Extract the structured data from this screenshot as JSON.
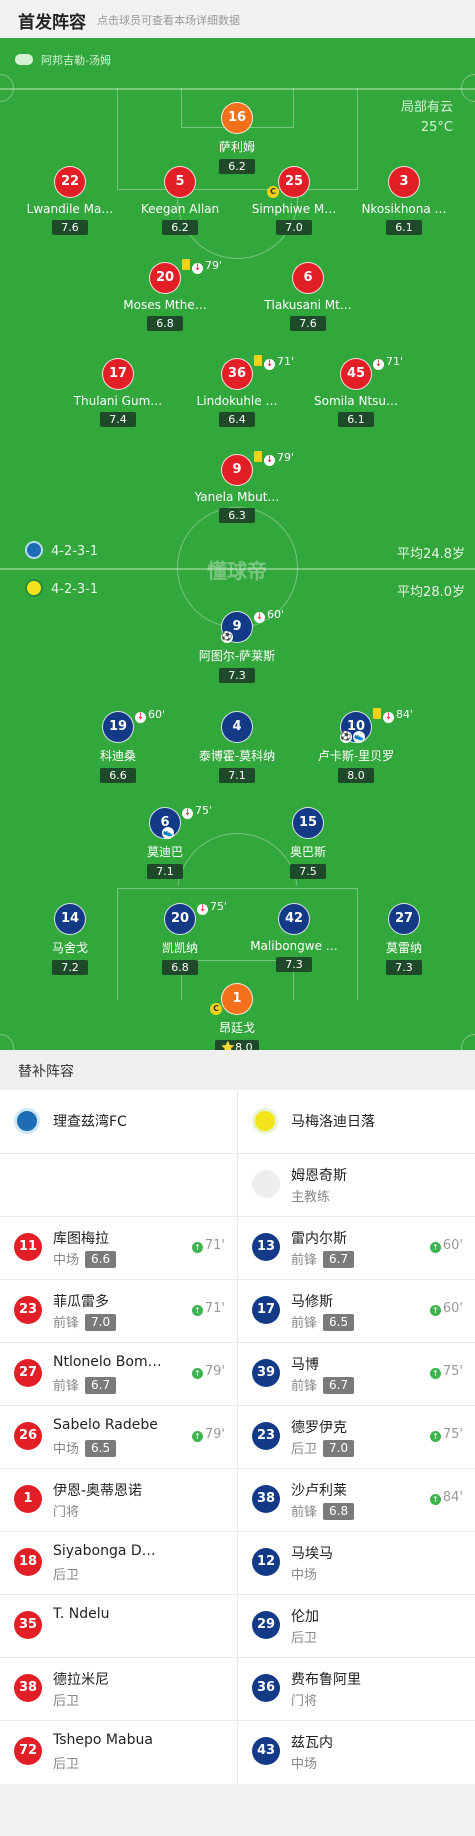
{
  "header": {
    "title": "首发阵容",
    "subtitle": "点击球员可查看本场详细数据"
  },
  "pitch": {
    "referee": "阿邦吉勒-汤姆",
    "weather": {
      "condition": "局部有云",
      "temperature": "25°C"
    },
    "watermark": "懂球帝",
    "home": {
      "formation": "4-2-3-1",
      "avg_age": "平均24.8岁"
    },
    "away": {
      "formation": "4-2-3-1",
      "avg_age": "平均28.0岁"
    }
  },
  "top_players": [
    {
      "num": "16",
      "name": "萨利姆",
      "rating": "6.2",
      "color": "gk"
    },
    {
      "num": "22",
      "name": "Lwandile Ma…",
      "rating": "7.6",
      "color": "red"
    },
    {
      "num": "5",
      "name": "Keegan Allan",
      "rating": "6.2",
      "color": "red"
    },
    {
      "num": "25",
      "name": "Simphiwe M…",
      "rating": "7.0",
      "color": "red",
      "captain": "C"
    },
    {
      "num": "3",
      "name": "Nkosikhona …",
      "rating": "6.1",
      "color": "red"
    },
    {
      "num": "20",
      "name": "Moses Mthe…",
      "rating": "6.8",
      "color": "red",
      "event": "79'",
      "yellow": true
    },
    {
      "num": "6",
      "name": "Tlakusani Mt…",
      "rating": "7.6",
      "color": "red"
    },
    {
      "num": "17",
      "name": "Thulani Gum…",
      "rating": "7.4",
      "color": "red"
    },
    {
      "num": "36",
      "name": "Lindokuhle …",
      "rating": "6.4",
      "color": "red",
      "event": "71'",
      "yellow": true
    },
    {
      "num": "45",
      "name": "Somila Ntsu…",
      "rating": "6.1",
      "color": "red",
      "event": "71'"
    },
    {
      "num": "9",
      "name": "Yanela Mbut…",
      "rating": "6.3",
      "color": "red",
      "event": "79'",
      "yellow": true
    }
  ],
  "bottom_players": [
    {
      "num": "9",
      "name": "阿图尔-萨莱斯",
      "rating": "7.3",
      "color": "blue",
      "event": "60'",
      "ball": "⚽"
    },
    {
      "num": "19",
      "name": "科迪桑",
      "rating": "6.6",
      "color": "blue",
      "event": "60'"
    },
    {
      "num": "4",
      "name": "泰博霍-莫科纳",
      "rating": "7.1",
      "color": "blue"
    },
    {
      "num": "10",
      "name": "卢卡斯-里贝罗",
      "rating": "8.0",
      "color": "blue",
      "event": "84'",
      "yellow": true,
      "ball": "⚽",
      "boot": "👟"
    },
    {
      "num": "6",
      "name": "莫迪巴",
      "rating": "7.1",
      "color": "blue",
      "event": "75'",
      "boot": "👟"
    },
    {
      "num": "15",
      "name": "奥巴斯",
      "rating": "7.5",
      "color": "blue"
    },
    {
      "num": "14",
      "name": "马舍戈",
      "rating": "7.2",
      "color": "blue"
    },
    {
      "num": "20",
      "name": "凯凯纳",
      "rating": "6.8",
      "color": "blue",
      "event": "75'"
    },
    {
      "num": "42",
      "name": "Malibongwe …",
      "rating": "7.3",
      "color": "blue"
    },
    {
      "num": "27",
      "name": "莫雷纳",
      "rating": "7.3",
      "color": "blue"
    },
    {
      "num": "1",
      "name": "昂廷戈",
      "rating": "⭐8.0",
      "color": "gk",
      "captain": "C"
    }
  ],
  "subs": {
    "title": "替补阵容",
    "home_team": "理查兹湾FC",
    "away_team": "马梅洛迪日落",
    "coach": {
      "name": "姆恩奇斯",
      "role": "主教练"
    },
    "home": [
      {
        "num": "11",
        "name": "库图梅拉",
        "pos": "中场",
        "rating": "6.6",
        "time": "71'"
      },
      {
        "num": "23",
        "name": "菲瓜雷多",
        "pos": "前锋",
        "rating": "7.0",
        "time": "71'"
      },
      {
        "num": "27",
        "name": "Ntlonelo Bom…",
        "pos": "前锋",
        "rating": "6.7",
        "time": "79'"
      },
      {
        "num": "26",
        "name": "Sabelo Radebe",
        "pos": "中场",
        "rating": "6.5",
        "time": "79'"
      },
      {
        "num": "1",
        "name": "伊恩-奥蒂恩诺",
        "pos": "门将"
      },
      {
        "num": "18",
        "name": "Siyabonga D…",
        "pos": "后卫"
      },
      {
        "num": "35",
        "name": "T. Ndelu",
        "pos": ""
      },
      {
        "num": "38",
        "name": "德拉米尼",
        "pos": "后卫"
      },
      {
        "num": "72",
        "name": "Tshepo Mabua",
        "pos": "后卫"
      }
    ],
    "away": [
      {
        "num": "13",
        "name": "雷内尔斯",
        "pos": "前锋",
        "rating": "6.7",
        "time": "60'"
      },
      {
        "num": "17",
        "name": "马修斯",
        "pos": "前锋",
        "rating": "6.5",
        "time": "60'"
      },
      {
        "num": "39",
        "name": "马博",
        "pos": "前锋",
        "rating": "6.7",
        "time": "75'"
      },
      {
        "num": "23",
        "name": "德罗伊克",
        "pos": "后卫",
        "rating": "7.0",
        "time": "75'"
      },
      {
        "num": "38",
        "name": "沙卢利莱",
        "pos": "前锋",
        "rating": "6.8",
        "time": "84'"
      },
      {
        "num": "12",
        "name": "马埃马",
        "pos": "中场"
      },
      {
        "num": "29",
        "name": "伦加",
        "pos": "后卫"
      },
      {
        "num": "36",
        "name": "费布鲁阿里",
        "pos": "门将"
      },
      {
        "num": "43",
        "name": "兹瓦内",
        "pos": "中场"
      }
    ]
  },
  "colors": {
    "pitch": "#32a83c",
    "home": "#e21f26",
    "away": "#123a86",
    "gk": "#f5701a"
  }
}
